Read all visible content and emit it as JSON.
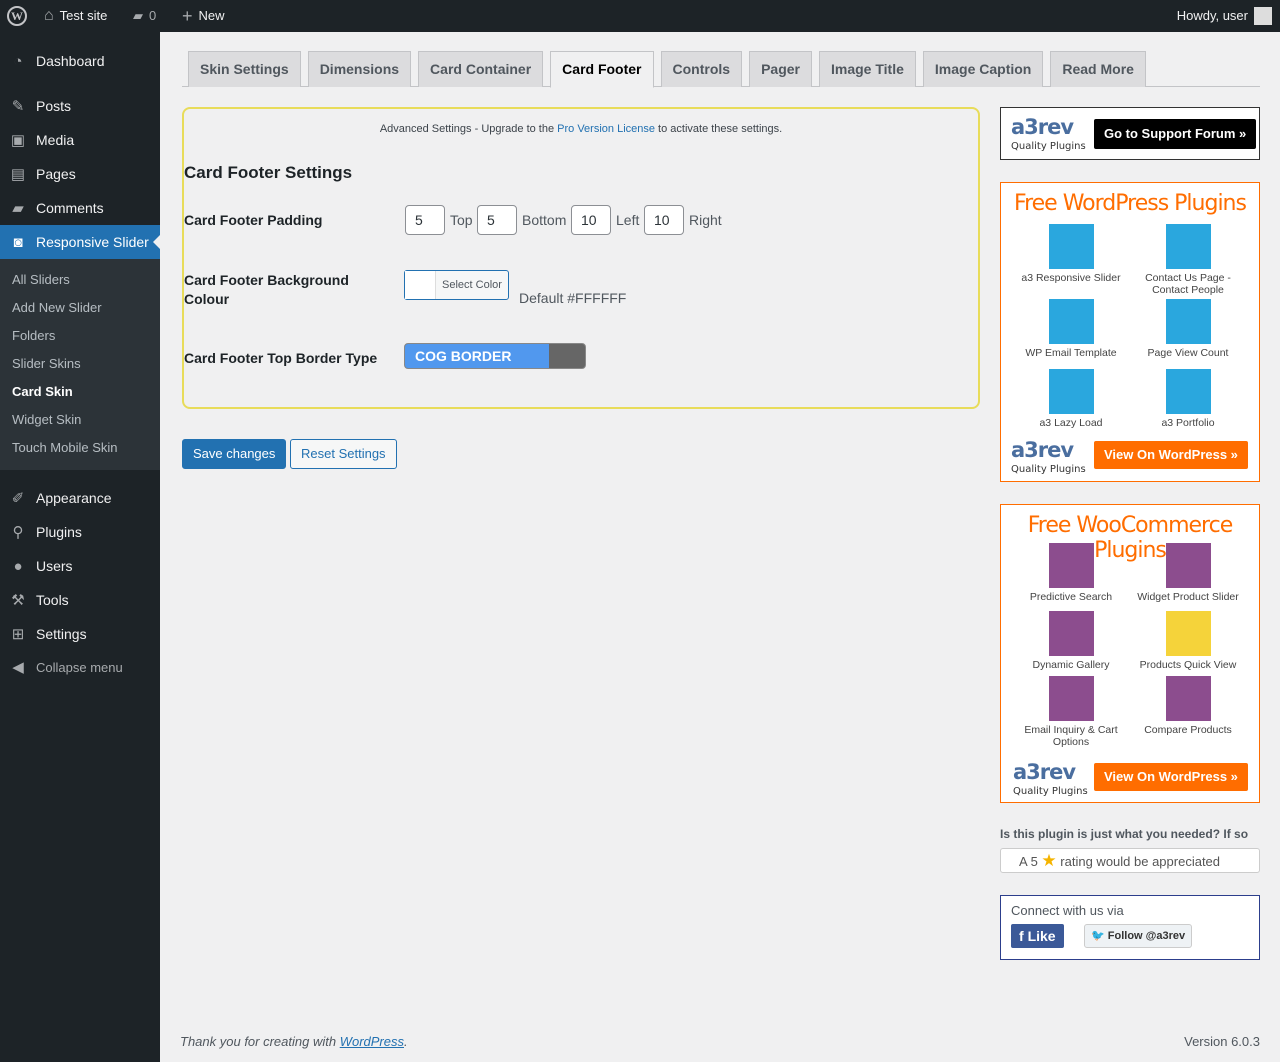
{
  "adminbar": {
    "site": "Test site",
    "comments": "0",
    "new": "New",
    "howdy": "Howdy, user"
  },
  "sidebar": {
    "items": [
      {
        "label": "Dashboard",
        "icon": "dashboard-icon"
      },
      {
        "label": "Posts",
        "icon": "pin-icon"
      },
      {
        "label": "Media",
        "icon": "media-icon"
      },
      {
        "label": "Pages",
        "icon": "pages-icon"
      },
      {
        "label": "Comments",
        "icon": "comment-icon"
      },
      {
        "label": "Responsive Slider",
        "icon": "camera-icon"
      },
      {
        "label": "Appearance",
        "icon": "brush-icon"
      },
      {
        "label": "Plugins",
        "icon": "plugin-icon"
      },
      {
        "label": "Users",
        "icon": "user-icon"
      },
      {
        "label": "Tools",
        "icon": "wrench-icon"
      },
      {
        "label": "Settings",
        "icon": "settings-icon"
      },
      {
        "label": "Collapse menu",
        "icon": "collapse-icon"
      }
    ],
    "submenu": [
      "All Sliders",
      "Add New Slider",
      "Folders",
      "Slider Skins",
      "Card Skin",
      "Widget Skin",
      "Touch Mobile Skin"
    ]
  },
  "tabs": [
    "Skin Settings",
    "Dimensions",
    "Card Container",
    "Card Footer",
    "Controls",
    "Pager",
    "Image Title",
    "Image Caption",
    "Read More"
  ],
  "box": {
    "note_pre": "Advanced Settings - Upgrade to the ",
    "note_link": "Pro Version License",
    "note_post": " to activate these settings.",
    "heading": "Card Footer Settings",
    "padding_label": "Card Footer Padding",
    "padding": {
      "top": "5",
      "top_label": "Top",
      "bottom": "5",
      "bottom_label": "Bottom",
      "left": "10",
      "left_label": "Left",
      "right": "10",
      "right_label": "Right"
    },
    "bg_label": "Card Footer Background Colour",
    "select_color": "Select Color",
    "bg_default": "Default #FFFFFF",
    "bg_color": "#FFFFFF",
    "border_label": "Card Footer Top Border Type",
    "border_value": "COG BORDER"
  },
  "buttons": {
    "save": "Save changes",
    "reset": "Reset Settings"
  },
  "side": {
    "a3rev": "a3rev",
    "quality": "Quality Plugins",
    "support": "Go to Support Forum »",
    "wp_title": "Free WordPress Plugins",
    "wp_plugins": [
      "a3 Responsive Slider",
      "Contact Us Page - Contact People",
      "WP Email Template",
      "Page View Count",
      "a3 Lazy Load",
      "a3 Portfolio"
    ],
    "view": "View On WordPress »",
    "woo_title": "Free WooCommerce Plugins",
    "woo_plugins": [
      "Predictive Search",
      "Widget Product Slider",
      "Dynamic Gallery",
      "Products Quick View",
      "Email Inquiry & Cart Options",
      "Compare Products"
    ],
    "rating_q": "Is this plugin is just what you needed? If so",
    "rating_pre": "A 5",
    "rating_post": "rating would be appreciated",
    "connect": "Connect with us via",
    "like": "Like",
    "follow": "Follow @a3rev"
  },
  "footer": {
    "thanks": "Thank you for creating with ",
    "wp": "WordPress",
    "version": "Version 6.0.3"
  }
}
